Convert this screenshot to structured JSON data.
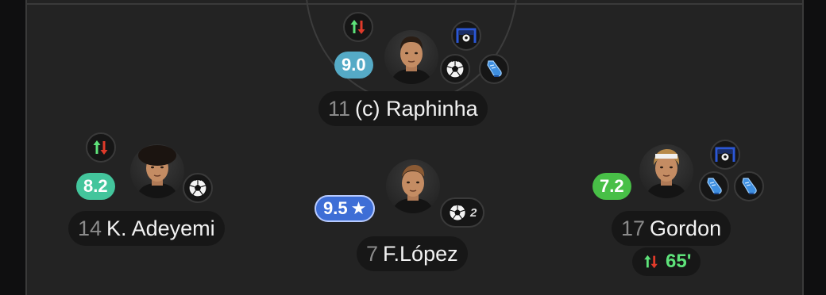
{
  "players": [
    {
      "id": "raphinha",
      "number": "11",
      "name": "(c) Raphinha",
      "rating": "9.0",
      "rating_color": "#55aac6",
      "icons": [
        "sub-arrows-icon",
        "goal-net-icon",
        "ball-icon",
        "boot-icon"
      ]
    },
    {
      "id": "adeyemi",
      "number": "14",
      "name": "K. Adeyemi",
      "rating": "8.2",
      "rating_color": "#43c59c",
      "icons": [
        "sub-arrows-icon",
        "ball-icon"
      ]
    },
    {
      "id": "lopez",
      "number": "7",
      "name": "F.López",
      "rating": "9.5",
      "rating_star": "★",
      "rating_color": "#3e6ed6",
      "goals_count": "2",
      "icons": [
        "ball-icon"
      ]
    },
    {
      "id": "gordon",
      "number": "17",
      "name": "Gordon",
      "rating": "7.2",
      "rating_color": "#48bf47",
      "sub_time": "65'",
      "icons": [
        "goal-net-icon",
        "boot-icon",
        "boot-icon",
        "sub-arrows-icon"
      ]
    }
  ],
  "colors": {
    "pitch": "#232323",
    "sub_in": "#5ee37a",
    "sub_out": "#e03a2a",
    "net": "#2b57d6"
  }
}
